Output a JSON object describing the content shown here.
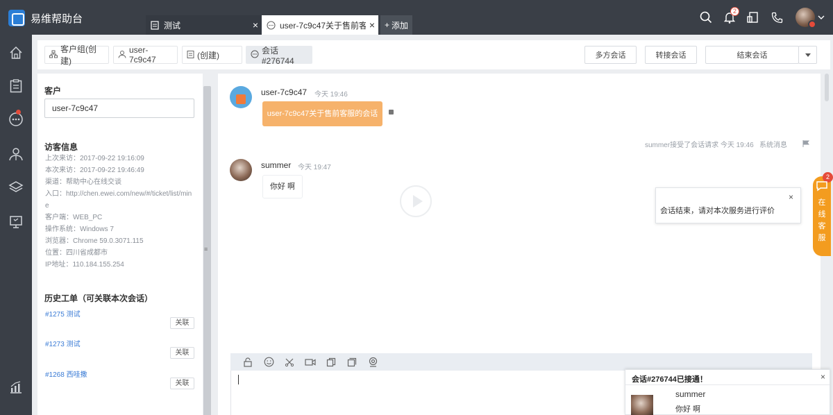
{
  "app": {
    "name": "易维帮助台"
  },
  "tabs": [
    {
      "label": "测试",
      "close": "×"
    },
    {
      "label": "user-7c9c47关于售前客...",
      "close": "×"
    }
  ],
  "add_tab": {
    "label": "添加"
  },
  "top": {
    "notification_count": "2"
  },
  "crumbs": [
    {
      "label": "客户组(创建)"
    },
    {
      "label": "user-7c9c47"
    },
    {
      "label": "(创建)"
    },
    {
      "label": "会话#276744"
    }
  ],
  "actions": {
    "multi": "多方会话",
    "transfer": "转接会话",
    "end": "结束会话"
  },
  "customer": {
    "title": "客户",
    "name": "user-7c9c47",
    "visitor_title": "访客信息",
    "info": [
      "上次来访：2017-09-22 19:16:09",
      "本次来访：2017-09-22 19:46:49",
      "渠道：帮助中心在线交谈",
      "入口：http://chen.ewei.com/new/#/ticket/list/mine",
      "客户端：WEB_PC",
      "操作系统：Windows 7",
      "浏览器：Chrome 59.0.3071.115",
      "位置：四川省成都市",
      "IP地址：110.184.155.254"
    ],
    "history_title": "历史工单（可关联本次会话）",
    "history": [
      {
        "label": "#1275 测试",
        "action": "关联"
      },
      {
        "label": "#1273 测试",
        "action": "关联"
      },
      {
        "label": "#1268 西哇撒",
        "action": "关联"
      }
    ]
  },
  "chat": {
    "msg1": {
      "name": "user-7c9c47",
      "time": "今天 19:46",
      "text": "user-7c9c47关于售前客服的会话"
    },
    "system": {
      "text": "summer接受了会话请求 今天 19:46",
      "source": "系统消息"
    },
    "msg2": {
      "name": "summer",
      "time": "今天 19:47",
      "text": "你好 啊"
    }
  },
  "tip": {
    "text": "会话结束，请对本次服务进行评价",
    "close": "×"
  },
  "online_service": {
    "label": "在线客服",
    "badge": "2"
  },
  "notification": {
    "title": "会话#276744已接通！",
    "close": "×",
    "name": "summer",
    "message": "你好 啊"
  }
}
